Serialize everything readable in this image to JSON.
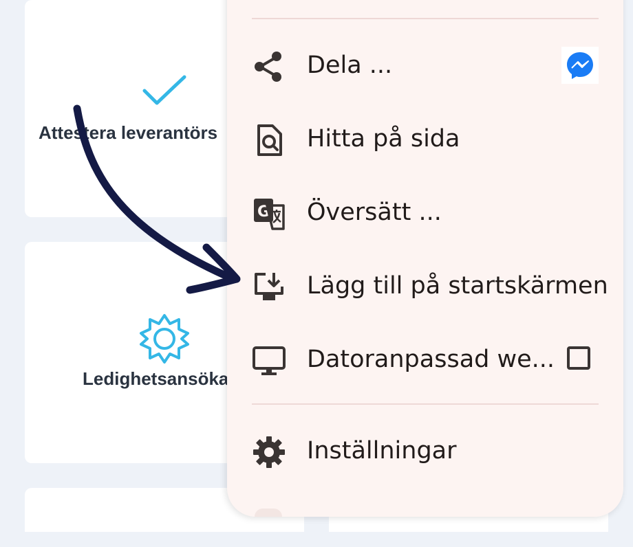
{
  "background_cards": [
    {
      "label": "Attestera leverantörs",
      "icon": "checkmark-icon"
    },
    {
      "label": "Ledighetsansöka",
      "icon": "sun-icon"
    }
  ],
  "menu": {
    "items": [
      {
        "label": "Dela ...",
        "icon": "share-icon",
        "trailing": "messenger-icon"
      },
      {
        "label": "Hitta på sida",
        "icon": "find-in-page-icon"
      },
      {
        "label": "Översätt ...",
        "icon": "translate-icon"
      },
      {
        "label": "Lägg till på startskärmen",
        "icon": "add-to-home-screen-icon"
      },
      {
        "label": "Datoranpassad we...",
        "icon": "desktop-icon",
        "trailing": "checkbox",
        "checked": false
      },
      {
        "label": "Inställningar",
        "icon": "settings-gear-icon"
      }
    ]
  },
  "colors": {
    "accent": "#34b7e6",
    "arrow": "#141a45",
    "menu_bg": "#fdf4f2",
    "messenger": "#1a7cf5"
  }
}
